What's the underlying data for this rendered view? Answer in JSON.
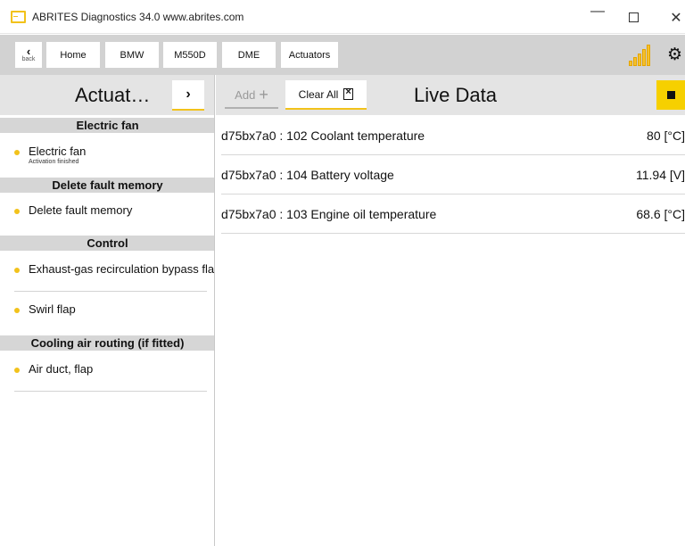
{
  "window": {
    "title": "ABRITES Diagnostics 34.0   www.abrites.com",
    "minimize": "—",
    "close": "✕"
  },
  "nav": {
    "back_arrow": "‹",
    "back_label": "back",
    "crumbs": [
      "Home",
      "BMW",
      "M550D",
      "DME",
      "Actuators"
    ],
    "signal_icon": "signal-strength-icon",
    "gear_glyph": "⚙"
  },
  "left": {
    "title": "Actuat…",
    "forward": "›",
    "sections": [
      {
        "header": "Electric fan",
        "items": [
          {
            "label": "Electric fan",
            "sub": "Activation finished"
          }
        ]
      },
      {
        "header": "Delete fault memory",
        "items": [
          {
            "label": "Delete fault memory"
          }
        ]
      },
      {
        "header": "Control",
        "items": [
          {
            "label": "Exhaust-gas recirculation bypass flap"
          },
          {
            "label": "Swirl flap"
          }
        ]
      },
      {
        "header": "Cooling air routing (if fitted)",
        "items": [
          {
            "label": "Air duct, flap"
          }
        ]
      }
    ]
  },
  "toolbar": {
    "add_label": "Add",
    "add_plus": "+",
    "clear_label": "Clear All",
    "title": "Live Data"
  },
  "live_data": [
    {
      "name": "d75bx7a0 : 102 Coolant temperature",
      "value": "80 [°C]"
    },
    {
      "name": "d75bx7a0 : 104 Battery voltage",
      "value": "11.94 [V]"
    },
    {
      "name": "d75bx7a0 : 103 Engine oil temperature",
      "value": "68.6 [°C]"
    }
  ],
  "colors": {
    "accent": "#f2c21b",
    "stop_button": "#f6d000"
  }
}
